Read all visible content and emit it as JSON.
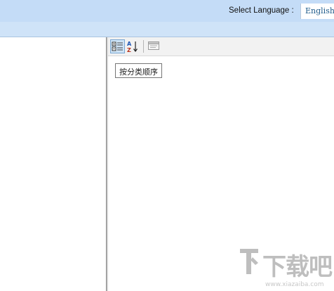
{
  "header": {
    "language_label": "Select Language :",
    "language_value": "English"
  },
  "property_grid": {
    "toolbar": {
      "categorized_icon": "categorized-icon",
      "alphabetical_icon": "sort-az-icon",
      "property_pages_icon": "property-pages-icon"
    },
    "tooltip": "按分类顺序"
  },
  "watermark": {
    "brand": "下载吧",
    "url": "www.xiazaiba.com"
  },
  "colors": {
    "header_bg": "#c4dcf7",
    "ribbon_bg": "#cfe3f8",
    "language_text": "#1d5a8a"
  }
}
